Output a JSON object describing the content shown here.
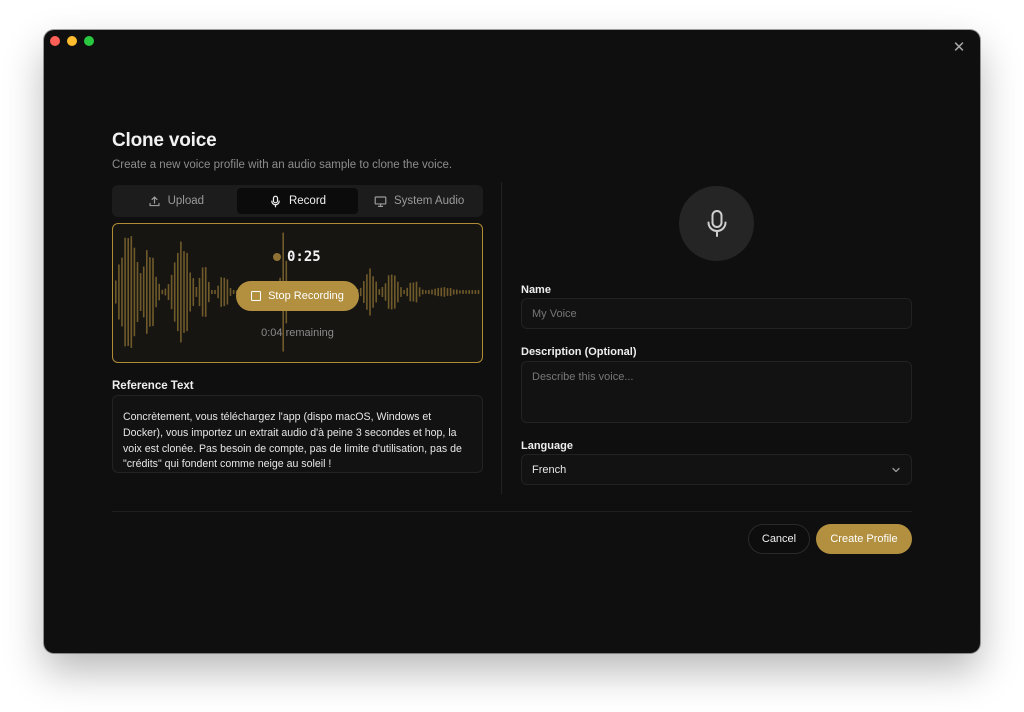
{
  "window": {
    "traffic_lights": {
      "close": "#ff5f57",
      "minimize": "#febc2e",
      "maximize": "#28c840"
    },
    "close_icon": "close-icon"
  },
  "dialog": {
    "title": "Clone voice",
    "subtitle": "Create a new voice profile with an audio sample to clone the voice."
  },
  "tabs": [
    {
      "label": "Upload",
      "icon": "upload-icon",
      "active": false
    },
    {
      "label": "Record",
      "icon": "microphone-icon",
      "active": true
    },
    {
      "label": "System Audio",
      "icon": "monitor-icon",
      "active": false
    }
  ],
  "recorder": {
    "timer": "0:25",
    "stop_label": "Stop Recording",
    "remaining": "0:04 remaining",
    "accent": "#b2903f"
  },
  "reference": {
    "label": "Reference Text",
    "text": "Concrètement, vous téléchargez l'app (dispo macOS, Windows et Docker), vous importez un extrait audio d'à peine 3 secondes et hop, la voix est clonée. Pas besoin de compte, pas de limite d'utilisation, pas de \"crédits\" qui fondent comme neige au soleil !"
  },
  "form": {
    "avatar_icon": "microphone-icon",
    "name_label": "Name",
    "name_placeholder": "My Voice",
    "description_label": "Description (Optional)",
    "description_placeholder": "Describe this voice...",
    "language_label": "Language",
    "language_value": "French"
  },
  "footer": {
    "cancel_label": "Cancel",
    "create_label": "Create Profile"
  }
}
